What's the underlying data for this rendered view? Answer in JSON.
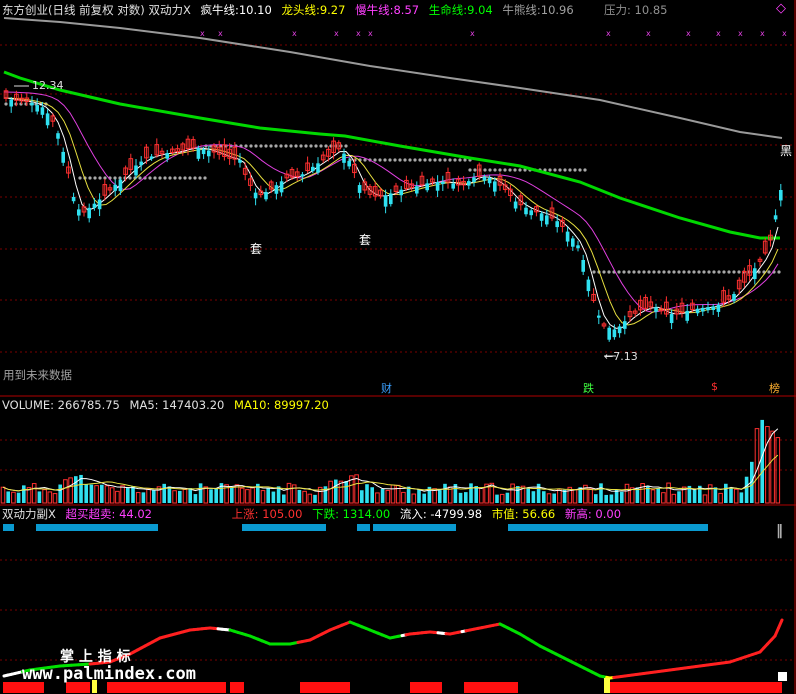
{
  "header": {
    "title": "东方创业(日线 前复权 对数) 双动力X",
    "items": [
      {
        "label": "疯牛线:",
        "value": "10.10",
        "color": "#ffffff"
      },
      {
        "label": "龙头线:",
        "value": "9.27",
        "color": "#ffff00"
      },
      {
        "label": "慢牛线:",
        "value": "8.57",
        "color": "#ff40ff"
      },
      {
        "label": "生命线:",
        "value": "9.04",
        "color": "#00ff00"
      },
      {
        "label": "牛熊线:",
        "value": "10.96",
        "color": "#a0a0a0"
      }
    ],
    "pressure_label": "压力: 10.85"
  },
  "price_panel": {
    "high_label": "12.34",
    "low_label": "←7.13",
    "future_data_note": "用到未来数据",
    "right_label": "黑",
    "tao_marks": [
      "套",
      "套"
    ],
    "bottom_tags": [
      {
        "text": "财",
        "color": "#3aa0ff"
      },
      {
        "text": "跌",
        "color": "#40ff40"
      },
      {
        "text": "$",
        "color": "#ff3030"
      },
      {
        "text": "榜",
        "color": "#ffb030"
      }
    ]
  },
  "volume_panel": {
    "label": "VOLUME: 266785.75",
    "ma5": "MA5: 147403.20",
    "ma10": "MA10: 89997.20"
  },
  "indicator_panel": {
    "name": "双动力副X",
    "items": [
      {
        "label": "超买超卖:",
        "value": "44.02",
        "color": "#ff40ff"
      },
      {
        "label": "上涨:",
        "value": "105.00",
        "color": "#ff3030"
      },
      {
        "label": "下跌:",
        "value": "1314.00",
        "color": "#00ff00"
      },
      {
        "label": "流入:",
        "value": "-4799.98",
        "color": "#ffffff"
      },
      {
        "label": "市值:",
        "value": "56.66",
        "color": "#ffff00"
      },
      {
        "label": "新高:",
        "value": "0.00",
        "color": "#ff40ff"
      }
    ],
    "watermark_text": "掌 上 指 标",
    "watermark_url": "www.palmindex.com"
  },
  "chart_data": {
    "type": "line",
    "scale": "log",
    "series": [
      {
        "name": "疯牛线",
        "color": "#ffffff",
        "end_value": 10.1
      },
      {
        "name": "龙头线",
        "color": "#ffff00",
        "end_value": 9.27
      },
      {
        "name": "慢牛线",
        "color": "#ff40ff",
        "end_value": 8.57
      },
      {
        "name": "生命线",
        "color": "#00ff00",
        "end_value": 9.04
      },
      {
        "name": "牛熊线",
        "color": "#a0a0a0",
        "end_value": 10.96
      }
    ],
    "annotations": [
      "12.34",
      "7.13"
    ]
  },
  "colors": {
    "up": "#ff3030",
    "down": "#30e0f0",
    "grid": "#7a0000",
    "band": "#0a9ad0"
  }
}
